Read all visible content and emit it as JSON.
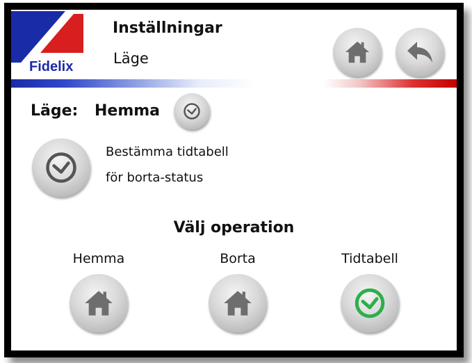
{
  "header": {
    "logo_text": "Fidelix",
    "title": "Inställningar",
    "subtitle": "Läge",
    "home_icon": "home-icon",
    "back_icon": "back-arrow-icon"
  },
  "mode": {
    "label": "Läge:",
    "value": "Hemma",
    "icon": "clock-icon"
  },
  "schedule": {
    "line1": "Bestämma tidtabell",
    "line2": "för borta-status",
    "icon": "clock-icon"
  },
  "operation": {
    "heading": "Välj operation",
    "options": [
      {
        "label": "Hemma",
        "icon": "home-icon"
      },
      {
        "label": "Borta",
        "icon": "home-icon"
      },
      {
        "label": "Tidtabell",
        "icon": "clock-icon",
        "active": true
      }
    ]
  },
  "colors": {
    "brand_blue": "#1a2ba8",
    "brand_red": "#d81e1e",
    "icon_gray": "#6e6e6e",
    "active_green": "#2fae4a"
  }
}
